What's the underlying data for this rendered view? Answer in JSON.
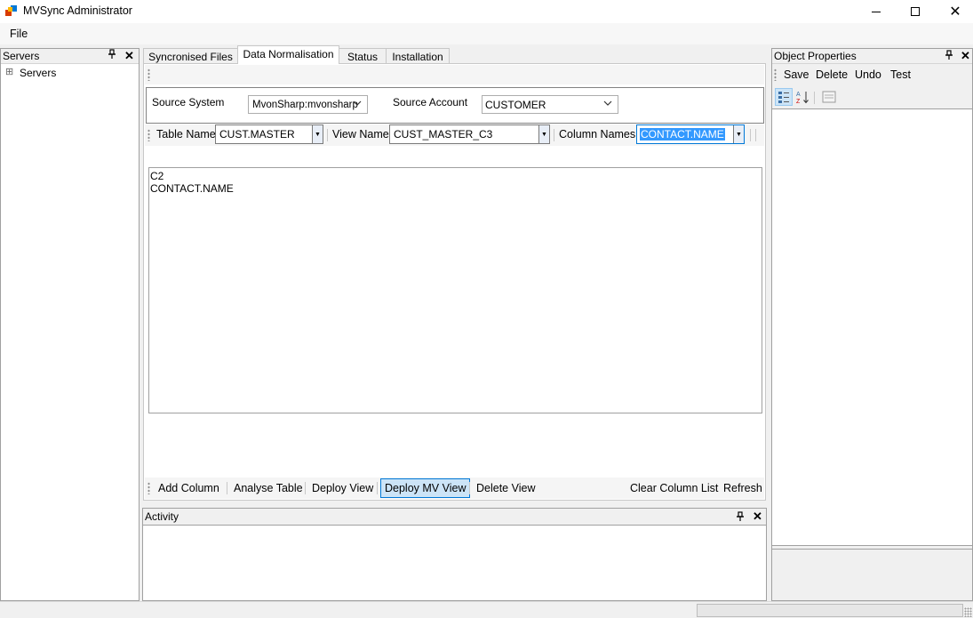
{
  "window": {
    "title": "MVSync Administrator",
    "minimize_glyph": "—",
    "maximize_glyph": "☐",
    "close_glyph": "✕"
  },
  "menu": {
    "file_label": "File"
  },
  "servers_panel": {
    "title": "Servers",
    "pin_glyph": "📌",
    "close_glyph": "✕",
    "tree": [
      {
        "label": "Servers",
        "expander": "⊞"
      }
    ]
  },
  "tabs": [
    {
      "label": "Syncronised Files",
      "active": false
    },
    {
      "label": "Data Normalisation",
      "active": true
    },
    {
      "label": "Status",
      "active": false
    },
    {
      "label": "Installation",
      "active": false
    }
  ],
  "source": {
    "system_label": "Source System",
    "system_value": "MvonSharp:mvonsharp",
    "account_label": "Source Account",
    "account_value": "CUSTOMER"
  },
  "selectors": {
    "table_label": "Table Name",
    "table_value": "CUST.MASTER",
    "view_label": "View Name",
    "view_value": "CUST_MASTER_C3",
    "columns_label": "Column Names",
    "columns_value": "CONTACT.NAME"
  },
  "column_list": {
    "lines": [
      "C2",
      "CONTACT.NAME"
    ]
  },
  "actions": {
    "add_column": "Add Column",
    "analyse_table": "Analyse Table",
    "deploy_view": "Deploy View",
    "deploy_mv_view": "Deploy MV View",
    "delete_view": "Delete View",
    "clear_column_list": "Clear Column List",
    "refresh": "Refresh"
  },
  "activity_panel": {
    "title": "Activity"
  },
  "object_properties": {
    "title": "Object Properties",
    "save": "Save",
    "delete": "Delete",
    "undo": "Undo",
    "test": "Test"
  },
  "colors": {
    "accent": "#0078d7",
    "selection": "#3399ff",
    "button_highlight": "#cce4f7"
  }
}
